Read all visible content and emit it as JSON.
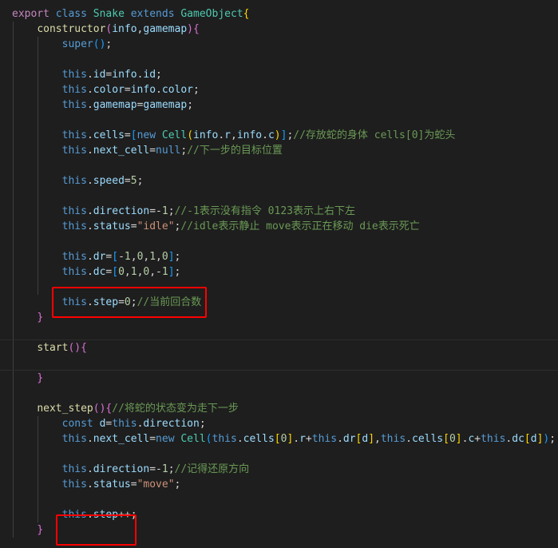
{
  "editor": {
    "language": "javascript",
    "lines": [
      [
        [
          "kwc",
          "export"
        ],
        [
          "pn",
          " "
        ],
        [
          "kw",
          "class"
        ],
        [
          "pn",
          " "
        ],
        [
          "cls",
          "Snake"
        ],
        [
          "pn",
          " "
        ],
        [
          "kw",
          "extends"
        ],
        [
          "pn",
          " "
        ],
        [
          "cls",
          "GameObject"
        ],
        [
          "b1",
          "{"
        ]
      ],
      [
        [
          "pn",
          "    "
        ],
        [
          "fn",
          "constructor"
        ],
        [
          "b2",
          "("
        ],
        [
          "var",
          "info"
        ],
        [
          "pn",
          ","
        ],
        [
          "var",
          "gamemap"
        ],
        [
          "b2",
          ")"
        ],
        [
          "b2",
          "{"
        ]
      ],
      [
        [
          "pn",
          "        "
        ],
        [
          "kw",
          "super"
        ],
        [
          "b3",
          "()"
        ],
        [
          "pn",
          ";"
        ]
      ],
      [
        [
          "pn",
          ""
        ]
      ],
      [
        [
          "pn",
          "        "
        ],
        [
          "kw",
          "this"
        ],
        [
          "pn",
          "."
        ],
        [
          "var",
          "id"
        ],
        [
          "pn",
          "="
        ],
        [
          "var",
          "info"
        ],
        [
          "pn",
          "."
        ],
        [
          "var",
          "id"
        ],
        [
          "pn",
          ";"
        ]
      ],
      [
        [
          "pn",
          "        "
        ],
        [
          "kw",
          "this"
        ],
        [
          "pn",
          "."
        ],
        [
          "var",
          "color"
        ],
        [
          "pn",
          "="
        ],
        [
          "var",
          "info"
        ],
        [
          "pn",
          "."
        ],
        [
          "var",
          "color"
        ],
        [
          "pn",
          ";"
        ]
      ],
      [
        [
          "pn",
          "        "
        ],
        [
          "kw",
          "this"
        ],
        [
          "pn",
          "."
        ],
        [
          "var",
          "gamemap"
        ],
        [
          "pn",
          "="
        ],
        [
          "var",
          "gamemap"
        ],
        [
          "pn",
          ";"
        ]
      ],
      [
        [
          "pn",
          ""
        ]
      ],
      [
        [
          "pn",
          "        "
        ],
        [
          "kw",
          "this"
        ],
        [
          "pn",
          "."
        ],
        [
          "var",
          "cells"
        ],
        [
          "pn",
          "="
        ],
        [
          "b3",
          "["
        ],
        [
          "kw",
          "new"
        ],
        [
          "pn",
          " "
        ],
        [
          "cls",
          "Cell"
        ],
        [
          "b1",
          "("
        ],
        [
          "var",
          "info"
        ],
        [
          "pn",
          "."
        ],
        [
          "var",
          "r"
        ],
        [
          "pn",
          ","
        ],
        [
          "var",
          "info"
        ],
        [
          "pn",
          "."
        ],
        [
          "var",
          "c"
        ],
        [
          "b1",
          ")"
        ],
        [
          "b3",
          "]"
        ],
        [
          "pn",
          ";"
        ],
        [
          "cm",
          "//存放蛇的身体 cells[0]为蛇头"
        ]
      ],
      [
        [
          "pn",
          "        "
        ],
        [
          "kw",
          "this"
        ],
        [
          "pn",
          "."
        ],
        [
          "var",
          "next_cell"
        ],
        [
          "pn",
          "="
        ],
        [
          "kw",
          "null"
        ],
        [
          "pn",
          ";"
        ],
        [
          "cm",
          "//下一步的目标位置"
        ]
      ],
      [
        [
          "pn",
          ""
        ]
      ],
      [
        [
          "pn",
          "        "
        ],
        [
          "kw",
          "this"
        ],
        [
          "pn",
          "."
        ],
        [
          "var",
          "speed"
        ],
        [
          "pn",
          "="
        ],
        [
          "num",
          "5"
        ],
        [
          "pn",
          ";"
        ]
      ],
      [
        [
          "pn",
          ""
        ]
      ],
      [
        [
          "pn",
          "        "
        ],
        [
          "kw",
          "this"
        ],
        [
          "pn",
          "."
        ],
        [
          "var",
          "direction"
        ],
        [
          "pn",
          "=-"
        ],
        [
          "num",
          "1"
        ],
        [
          "pn",
          ";"
        ],
        [
          "cm",
          "//-1表示没有指令 0123表示上右下左"
        ]
      ],
      [
        [
          "pn",
          "        "
        ],
        [
          "kw",
          "this"
        ],
        [
          "pn",
          "."
        ],
        [
          "var",
          "status"
        ],
        [
          "pn",
          "="
        ],
        [
          "str",
          "\"idle\""
        ],
        [
          "pn",
          ";"
        ],
        [
          "cm",
          "//idle表示静止 move表示正在移动 die表示死亡"
        ]
      ],
      [
        [
          "pn",
          ""
        ]
      ],
      [
        [
          "pn",
          "        "
        ],
        [
          "kw",
          "this"
        ],
        [
          "pn",
          "."
        ],
        [
          "var",
          "dr"
        ],
        [
          "pn",
          "="
        ],
        [
          "b3",
          "["
        ],
        [
          "pn",
          "-"
        ],
        [
          "num",
          "1"
        ],
        [
          "pn",
          ","
        ],
        [
          "num",
          "0"
        ],
        [
          "pn",
          ","
        ],
        [
          "num",
          "1"
        ],
        [
          "pn",
          ","
        ],
        [
          "num",
          "0"
        ],
        [
          "b3",
          "]"
        ],
        [
          "pn",
          ";"
        ]
      ],
      [
        [
          "pn",
          "        "
        ],
        [
          "kw",
          "this"
        ],
        [
          "pn",
          "."
        ],
        [
          "var",
          "dc"
        ],
        [
          "pn",
          "="
        ],
        [
          "b3",
          "["
        ],
        [
          "num",
          "0"
        ],
        [
          "pn",
          ","
        ],
        [
          "num",
          "1"
        ],
        [
          "pn",
          ","
        ],
        [
          "num",
          "0"
        ],
        [
          "pn",
          ",-"
        ],
        [
          "num",
          "1"
        ],
        [
          "b3",
          "]"
        ],
        [
          "pn",
          ";"
        ]
      ],
      [
        [
          "pn",
          ""
        ]
      ],
      [
        [
          "pn",
          "        "
        ],
        [
          "kw",
          "this"
        ],
        [
          "pn",
          "."
        ],
        [
          "var",
          "step"
        ],
        [
          "pn",
          "="
        ],
        [
          "num",
          "0"
        ],
        [
          "pn",
          ";"
        ],
        [
          "cm",
          "//当前回合数"
        ]
      ],
      [
        [
          "pn",
          "    "
        ],
        [
          "b2",
          "}"
        ]
      ],
      [
        [
          "pn",
          ""
        ]
      ],
      [
        [
          "pn",
          "    "
        ],
        [
          "fn",
          "start"
        ],
        [
          "b2",
          "()"
        ],
        [
          "b2",
          "{"
        ]
      ],
      [
        [
          "pn",
          ""
        ]
      ],
      [
        [
          "pn",
          "    "
        ],
        [
          "b2",
          "}"
        ]
      ],
      [
        [
          "pn",
          ""
        ]
      ],
      [
        [
          "pn",
          "    "
        ],
        [
          "fn",
          "next_step"
        ],
        [
          "b2",
          "()"
        ],
        [
          "b2",
          "{"
        ],
        [
          "cm",
          "//将蛇的状态变为走下一步"
        ]
      ],
      [
        [
          "pn",
          "        "
        ],
        [
          "kw",
          "const"
        ],
        [
          "pn",
          " "
        ],
        [
          "var",
          "d"
        ],
        [
          "pn",
          "="
        ],
        [
          "kw",
          "this"
        ],
        [
          "pn",
          "."
        ],
        [
          "var",
          "direction"
        ],
        [
          "pn",
          ";"
        ]
      ],
      [
        [
          "pn",
          "        "
        ],
        [
          "kw",
          "this"
        ],
        [
          "pn",
          "."
        ],
        [
          "var",
          "next_cell"
        ],
        [
          "pn",
          "="
        ],
        [
          "kw",
          "new"
        ],
        [
          "pn",
          " "
        ],
        [
          "cls",
          "Cell"
        ],
        [
          "b3",
          "("
        ],
        [
          "kw",
          "this"
        ],
        [
          "pn",
          "."
        ],
        [
          "var",
          "cells"
        ],
        [
          "b1",
          "["
        ],
        [
          "num",
          "0"
        ],
        [
          "b1",
          "]"
        ],
        [
          "pn",
          "."
        ],
        [
          "var",
          "r"
        ],
        [
          "pn",
          "+"
        ],
        [
          "kw",
          "this"
        ],
        [
          "pn",
          "."
        ],
        [
          "var",
          "dr"
        ],
        [
          "b1",
          "["
        ],
        [
          "var",
          "d"
        ],
        [
          "b1",
          "]"
        ],
        [
          "pn",
          ","
        ],
        [
          "kw",
          "this"
        ],
        [
          "pn",
          "."
        ],
        [
          "var",
          "cells"
        ],
        [
          "b1",
          "["
        ],
        [
          "num",
          "0"
        ],
        [
          "b1",
          "]"
        ],
        [
          "pn",
          "."
        ],
        [
          "var",
          "c"
        ],
        [
          "pn",
          "+"
        ],
        [
          "kw",
          "this"
        ],
        [
          "pn",
          "."
        ],
        [
          "var",
          "dc"
        ],
        [
          "b1",
          "["
        ],
        [
          "var",
          "d"
        ],
        [
          "b1",
          "]"
        ],
        [
          "b3",
          ")"
        ],
        [
          "pn",
          ";"
        ]
      ],
      [
        [
          "pn",
          ""
        ]
      ],
      [
        [
          "pn",
          "        "
        ],
        [
          "kw",
          "this"
        ],
        [
          "pn",
          "."
        ],
        [
          "var",
          "direction"
        ],
        [
          "pn",
          "=-"
        ],
        [
          "num",
          "1"
        ],
        [
          "pn",
          ";"
        ],
        [
          "cm",
          "//记得还原方向"
        ]
      ],
      [
        [
          "pn",
          "        "
        ],
        [
          "kw",
          "this"
        ],
        [
          "pn",
          "."
        ],
        [
          "var",
          "status"
        ],
        [
          "pn",
          "="
        ],
        [
          "str",
          "\"move\""
        ],
        [
          "pn",
          ";"
        ]
      ],
      [
        [
          "pn",
          ""
        ]
      ],
      [
        [
          "pn",
          "        "
        ],
        [
          "kw",
          "this"
        ],
        [
          "pn",
          "."
        ],
        [
          "var",
          "step"
        ],
        [
          "pn",
          "++;"
        ]
      ],
      [
        [
          "pn",
          "    "
        ],
        [
          "b2",
          "}"
        ]
      ]
    ]
  },
  "highlights": [
    {
      "label": "step-init-highlight",
      "line": 19
    },
    {
      "label": "step-increment-highlight",
      "line": 34
    }
  ]
}
